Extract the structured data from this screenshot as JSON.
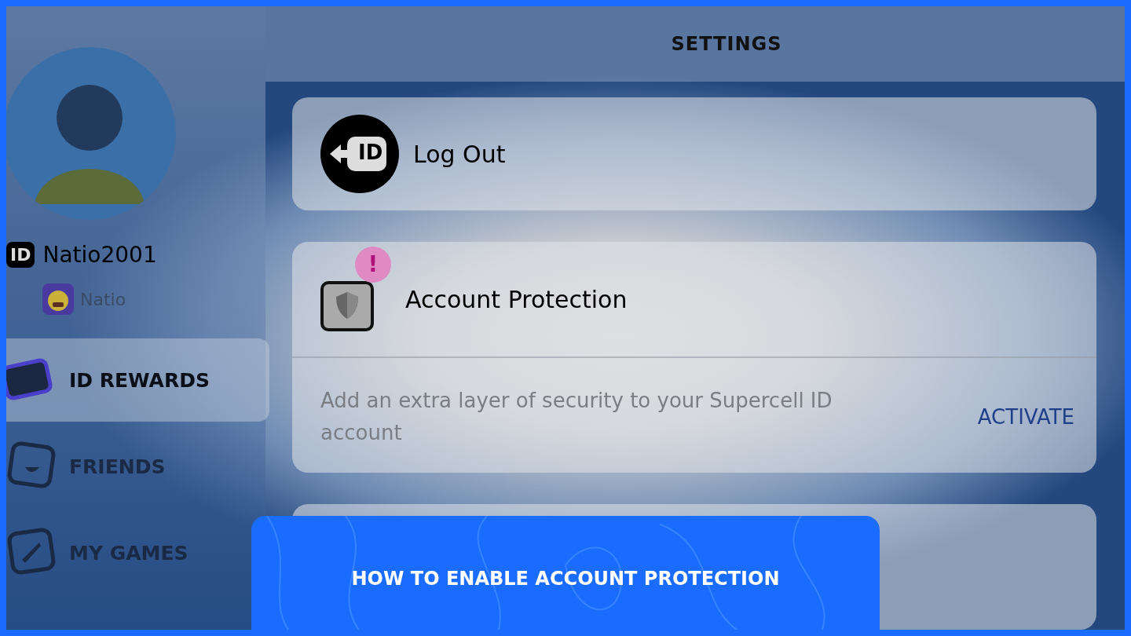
{
  "header": {
    "title": "SETTINGS"
  },
  "profile": {
    "id_badge": "ID",
    "username": "Natio2001",
    "game_account": "Natio"
  },
  "sidebar": {
    "items": [
      {
        "label": "ID REWARDS",
        "kind": "rewards",
        "selected": true
      },
      {
        "label": "FRIENDS",
        "kind": "friends",
        "selected": false
      },
      {
        "label": "MY GAMES",
        "kind": "games",
        "selected": false
      }
    ]
  },
  "settings": [
    {
      "kind": "logout",
      "title": "Log Out",
      "icon_text": "ID"
    },
    {
      "kind": "protection",
      "title": "Account Protection",
      "alert": true,
      "alert_text": "!",
      "description": "Add an extra layer of security to your Supercell ID account",
      "action": "ACTIVATE"
    },
    {
      "kind": "empty"
    }
  ],
  "banner": {
    "caption": "HOW TO ENABLE ACCOUNT PROTECTION"
  }
}
